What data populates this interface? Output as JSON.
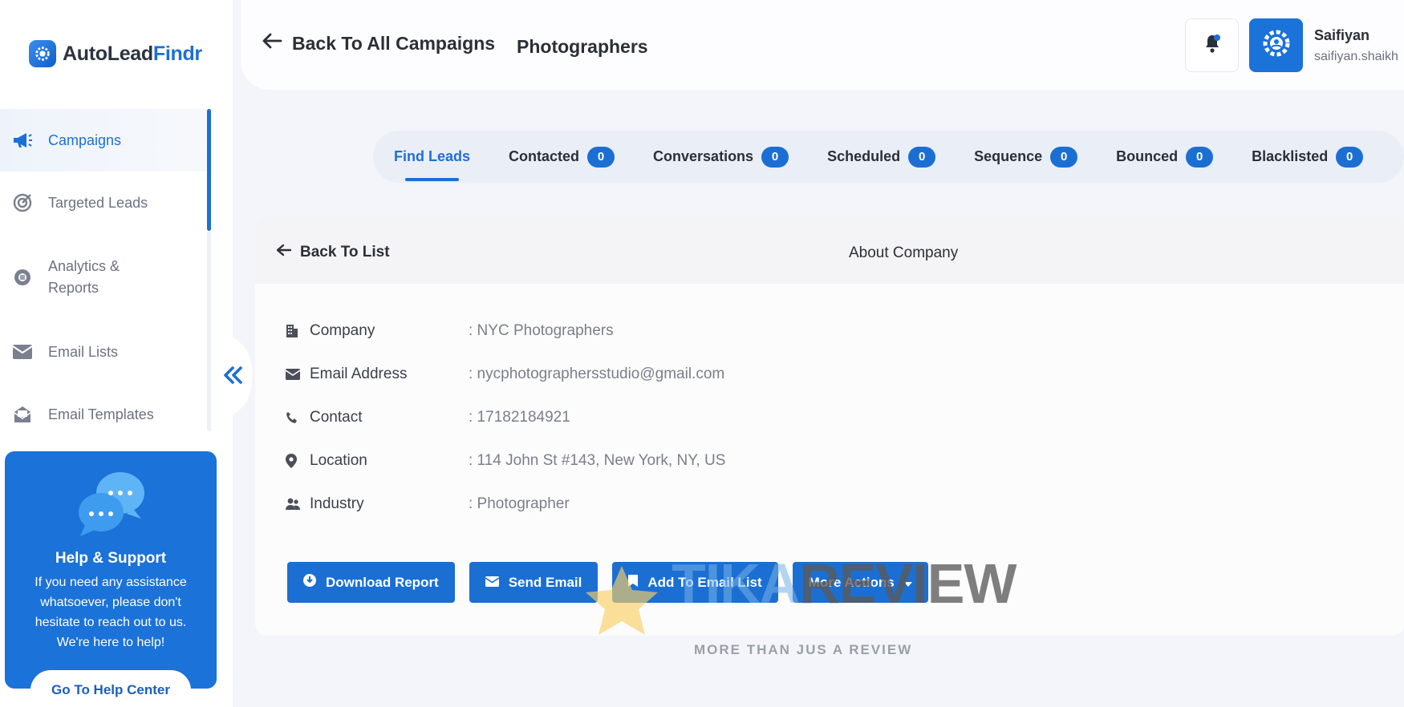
{
  "app": {
    "brand_a": "AutoLead",
    "brand_b": "Findr",
    "accent": "#1d6fd6"
  },
  "sidebar": {
    "items": [
      {
        "label": "Campaigns",
        "icon": "megaphone-icon"
      },
      {
        "label": "Targeted Leads",
        "icon": "target-icon"
      },
      {
        "label": "Analytics &\nReports",
        "icon": "analytics-icon"
      },
      {
        "label": "Email Lists",
        "icon": "envelope-icon"
      },
      {
        "label": "Email Templates",
        "icon": "template-icon"
      }
    ],
    "help": {
      "title": "Help & Support",
      "text": "If you need any assistance whatsoever, please don't hesitate to reach out to us. We're here to help!",
      "button": "Go To Help Center"
    }
  },
  "header": {
    "back_label": "Back To All Campaigns",
    "campaign": "Photographers",
    "user_name": "Saifiyan",
    "user_email": "saifiyan.shaikh"
  },
  "tabs": [
    {
      "label": "Find Leads",
      "count": null
    },
    {
      "label": "Contacted",
      "count": "0"
    },
    {
      "label": "Conversations",
      "count": "0"
    },
    {
      "label": "Scheduled",
      "count": "0"
    },
    {
      "label": "Sequence",
      "count": "0"
    },
    {
      "label": "Bounced",
      "count": "0"
    },
    {
      "label": "Blacklisted",
      "count": "0"
    }
  ],
  "detail": {
    "back_label": "Back To List",
    "section_title": "About Company",
    "fields": [
      {
        "label": "Company",
        "value": ": NYC Photographers",
        "icon": "building-icon"
      },
      {
        "label": "Email Address",
        "value": ": nycphotographersstudio@gmail.com",
        "icon": "envelope-icon"
      },
      {
        "label": "Contact",
        "value": ": 17182184921",
        "icon": "phone-icon"
      },
      {
        "label": "Location",
        "value": ": 114 John St #143, New York, NY, US",
        "icon": "location-pin-icon"
      },
      {
        "label": "Industry",
        "value": ": Photographer",
        "icon": "people-icon"
      }
    ],
    "actions": {
      "download": "Download Report",
      "send": "Send Email",
      "add": "Add To Email List",
      "more": "More Actions"
    }
  },
  "watermark": {
    "word_a": "TIKA",
    "word_b": "REVIEW",
    "tagline": "MORE THAN JUS A REVIEW"
  }
}
